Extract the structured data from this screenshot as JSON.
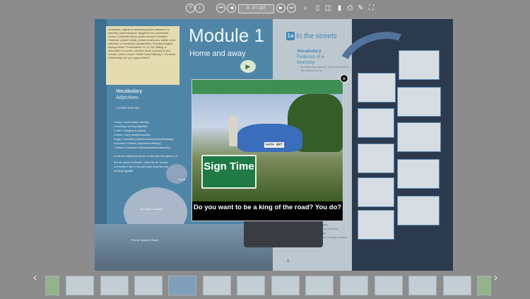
{
  "toolbar": {
    "page_indicator": "8 - 9 / 187",
    "icons": [
      "help-icon",
      "info-icon",
      "first-page-icon",
      "prev-page-icon",
      "next-page-icon",
      "last-page-icon",
      "search-icon",
      "single-page-icon",
      "double-page-icon",
      "bookmark-icon",
      "print-icon",
      "pen-icon",
      "fullscreen-icon"
    ]
  },
  "left_page": {
    "module_title": "Module 1",
    "module_subtitle": "Home and away",
    "notes": "Vocabulary: adjectives describing places; features of a town/city; public transport; dangers in the countryside; homes; household chores; public services & facilities. Grammar: present simple, present continuous; stative verbs; adjectives of movement; comparatives. Everyday English: buying a ticket. Pronunciation: /s/, /z/, /iz/. Writing: a description of a scene; narrative about a journey in your country. Culture Corner: Pacific Coast Highway 1. Curricular (Citizenship): Are you a good citizen?",
    "vocab_heading": "Vocabulary",
    "vocab_sub": "Adjectives",
    "exercise_1": "1  Listen and say.",
    "vocab_list": [
      "1 busy ≠ quiet (place, streets)",
      "2 exciting ≠ boring (nightlife)",
      "3 safe ≠ dangerous (place)",
      "4 clean ≠ dirty (beaches/parks)",
      "5 ugly ≠ beautiful (city/town/beach/parks/buildings)",
      "6 modern ≠ historic (city/town/buildings)",
      "7 cheap ≠ expensive (shops/hotels/restaurants)"
    ],
    "exercise_2": "2  Use the adjectives above to describe the places 1-3.",
    "example_text": "Rio de Janeiro in Brazil. I think Rio de Janeiro is a modern city. It has got clean beaches and exciting nightlife.",
    "caption_montreal": "Montreal, Canada",
    "caption_rio": "Rio de Janeiro, Brazil",
    "caption_accra": "Accra"
  },
  "right_page": {
    "section_letter": "1a",
    "section_title": "In the streets",
    "vocab_heading": "Vocabulary",
    "vocab_sub": "Features of a town/city",
    "exercise_a": "a) Match the words (1-10) to the items in the pictures (A-J).",
    "list": [
      "A The police car is going around a roundabout.",
      "B The police car is at the traffic lights.",
      "C The suspect doesn't move any pedestrians.",
      "D The suspect goes under a bridge.",
      "E The police car follows the suspect through a tunnel."
    ],
    "page_number": "8"
  },
  "modal": {
    "sign_text": "Sign Time",
    "plate_text": "G454 BRT",
    "subtitle": "Do you want to be a king of the road? You do?",
    "close_label": "×"
  },
  "thumbnails": {
    "prev_label": "‹",
    "next_label": "›",
    "count": 14
  }
}
